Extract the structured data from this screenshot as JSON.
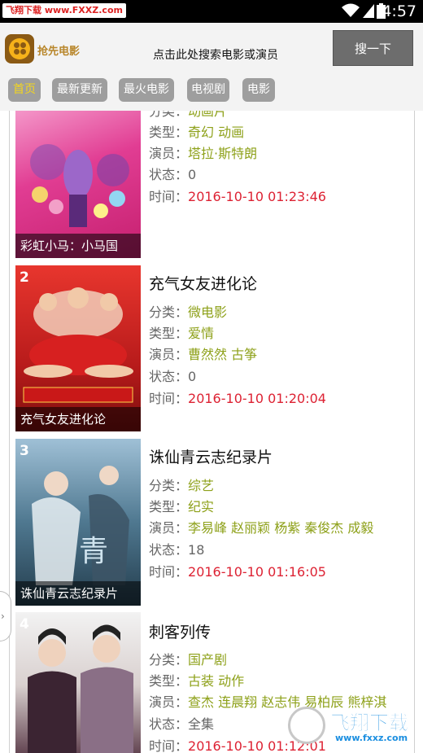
{
  "status_bar": {
    "watermark": "飞翔下载 www.FXXZ.com",
    "time": "4:57"
  },
  "header": {
    "app_name": "抢先电影",
    "search_hint": "点击此处搜索电影或演员",
    "search_button": "搜一下"
  },
  "nav": {
    "tabs": [
      "首页",
      "最新更新",
      "最火电影",
      "电视剧",
      "电影"
    ],
    "active_index": 0
  },
  "labels": {
    "category": "分类：",
    "genre": "类型：",
    "actors": "演员：",
    "status": "状态：",
    "time": "时间："
  },
  "movies": [
    {
      "rank": "",
      "title": "",
      "poster_caption": "彩虹小马：小马国",
      "category": "动画片",
      "genre": "奇幻 动画",
      "actors": "塔拉·斯特朗",
      "status": "0",
      "time": "2016-10-10 01:23:46"
    },
    {
      "rank": "2",
      "title": "充气女友进化论",
      "poster_caption": "充气女友进化论",
      "category": "微电影",
      "genre": "爱情",
      "actors": "曹然然 古筝",
      "status": "0",
      "time": "2016-10-10 01:20:04"
    },
    {
      "rank": "3",
      "title": "诛仙青云志纪录片",
      "poster_caption": "诛仙青云志纪录片",
      "category": "综艺",
      "genre": "纪实",
      "actors": "李易峰 赵丽颖 杨紫 秦俊杰 成毅",
      "status": "18",
      "time": "2016-10-10 01:16:05"
    },
    {
      "rank": "4",
      "title": "刺客列传",
      "poster_caption": "",
      "category": "国产剧",
      "genre": "古装 动作",
      "actors": "查杰 连晨翔 赵志伟 易柏辰 熊梓淇",
      "status": "全集",
      "time": "2016-10-10 01:12:01"
    }
  ],
  "watermark_logo": {
    "text": "飞翔下载",
    "url": "www.fxxz.com"
  },
  "colors": {
    "accent_green": "#8ea11a",
    "time_red": "#d23",
    "tab_active_text": "#f3d51f",
    "tab_bg": "#9e9e9e"
  }
}
